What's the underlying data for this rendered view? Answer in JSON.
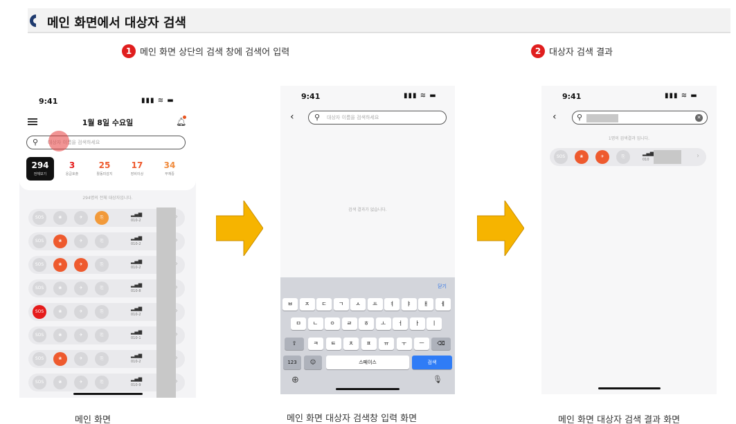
{
  "header": {
    "title": "메인 화면에서 대상자 검색"
  },
  "steps": [
    {
      "num": "1",
      "text": "메인 화면 상단의 검색 창에 검색어 입력"
    },
    {
      "num": "2",
      "text": "대상자 검색 결과"
    }
  ],
  "captions": [
    "메인 화면",
    "메인 화면 대상자 검색창 입력 화면",
    "메인 화면 대상자 검색 결과 화면"
  ],
  "colors": {
    "accent_red": "#e01e1e",
    "arrow_yellow": "#f6b400",
    "badge_orange": "#ee5a2e",
    "key_blue": "#2f7cf6"
  },
  "phone1": {
    "time": "9:41",
    "status": "▮▮▮ ≋ ▬",
    "date": "1월 8일 수요일",
    "menu_icon": "hamburger-icon",
    "bell_icon": "bell-icon",
    "search_placeholder": "대상자 이름을 검색하세요",
    "stats": [
      {
        "value": "294",
        "label": "전체보기"
      },
      {
        "value": "3",
        "label": "응급호출"
      },
      {
        "value": "25",
        "label": "활동미감지"
      },
      {
        "value": "17",
        "label": "장비이상"
      },
      {
        "value": "34",
        "label": "부재중"
      }
    ],
    "total_text": "294명의 전체 대상자입니다.",
    "badge_labels": [
      "SOS",
      "❀",
      "✈",
      "⎘"
    ],
    "rows": [
      {
        "phone": "010-2",
        "active": [
          3
        ]
      },
      {
        "phone": "010-2",
        "active": [
          1
        ]
      },
      {
        "phone": "010-2",
        "active": [
          1,
          2
        ]
      },
      {
        "phone": "010-8",
        "active": []
      },
      {
        "phone": "010-2",
        "active": [
          0
        ]
      },
      {
        "phone": "010-1",
        "active": []
      },
      {
        "phone": "010-2",
        "active": [
          1
        ]
      },
      {
        "phone": "010-9",
        "active": []
      }
    ]
  },
  "phone2": {
    "time": "9:41",
    "status": "▮▮▮ ≋ ▬",
    "search_placeholder": "대상자 이름을 검색하세요",
    "no_result": "검색 결과가 없습니다.",
    "done_label": "닫기",
    "keyboard": {
      "row1": [
        "ㅂ",
        "ㅈ",
        "ㄷ",
        "ㄱ",
        "ㅅ",
        "ㅛ",
        "ㅕ",
        "ㅑ",
        "ㅐ",
        "ㅔ"
      ],
      "row2": [
        "ㅁ",
        "ㄴ",
        "ㅇ",
        "ㄹ",
        "ㅎ",
        "ㅗ",
        "ㅓ",
        "ㅏ",
        "ㅣ"
      ],
      "row3": [
        "ㅋ",
        "ㅌ",
        "ㅊ",
        "ㅍ",
        "ㅠ",
        "ㅜ",
        "ㅡ"
      ],
      "shift": "⇧",
      "backspace": "⌫",
      "num": "123",
      "emoji": "☺",
      "space": "스페이스",
      "search": "검색",
      "globe": "⊕",
      "mic": "🎙"
    }
  },
  "phone3": {
    "time": "9:41",
    "status": "▮▮▮ ≋ ▬",
    "result_count": "1명의 검색결과 입니다.",
    "clear_icon": "✕",
    "row_phone": "010"
  }
}
